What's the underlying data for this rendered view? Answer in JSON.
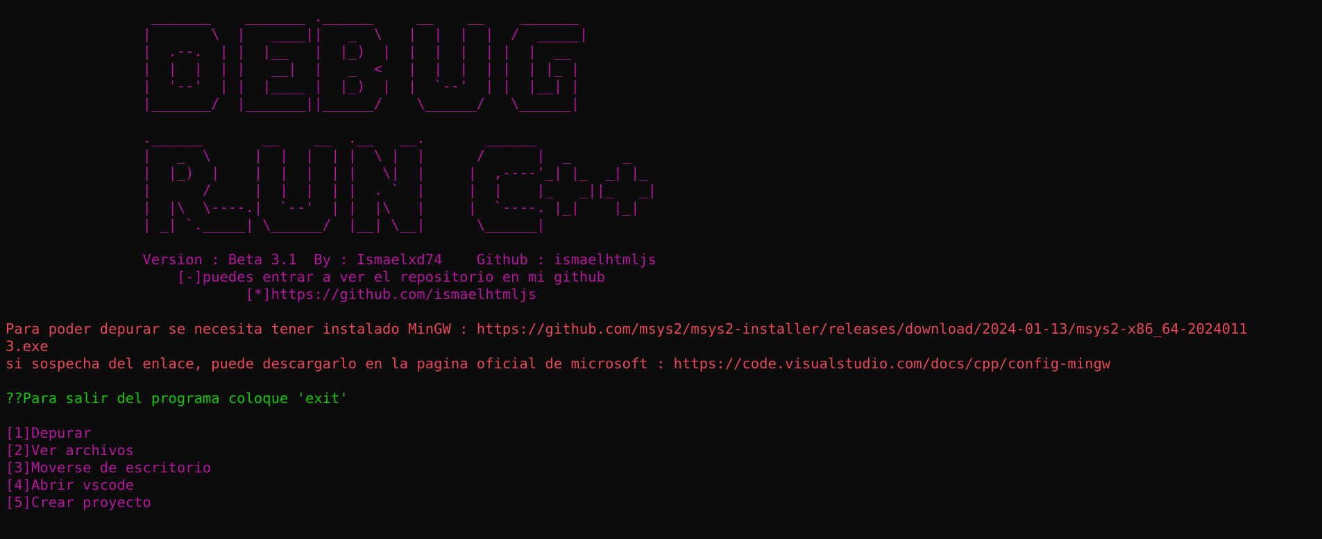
{
  "colors": {
    "background": "#0c0c0c",
    "magenta": "#b4169e",
    "red": "#e74856",
    "green": "#16c60c"
  },
  "banner": {
    "debug_art": "                 _______    _______ .______     __    __    _______ \n                |       \\  |   ____||   _  \\   |  |  |  |  /  _____|\n                |  .--.  | |  |__   |  |_)  |  |  |  |  | |  |  __  \n                |  |  |  | |   __|  |   _  <   |  |  |  | |  | |_ | \n                |  '--'  | |  |____ |  |_)  |  |  `--'  | |  |__| | \n                |_______/  |_______||______/    \\______/   \\______| ",
    "run_art": "                .______       __    __  .__   __.       ______     \n                |   _  \\     |  |  |  | |  \\ |  |      /      |  _      _   \n                |  |_)  |    |  |  |  | |   \\|  |     |  ,----'_| |_  _| |_ \n                |      /     |  |  |  | |  . `  |     |  |    |_   _||_   _|\n                |  |\\  \\----.|  `--'  | |  |\\   |     |  `----. |_|    |_|  \n                | _| `._____| \\______/  |__| \\__|      \\______|             ",
    "version_line": "                Version : Beta 3.1  By : Ismaelxd74    Github : ismaelhtmljs",
    "repo_line": "                    [-]puedes entrar a ver el repositorio en mi github",
    "url_line": "                            [*]https://github.com/ismaelhtmljs"
  },
  "notice": {
    "line1": "Para poder depurar se necesita tener instalado MinGW : https://github.com/msys2/msys2-installer/releases/download/2024-01-13/msys2-x86_64-2024011",
    "line2": "3.exe",
    "line3": "si sospecha del enlace, puede descargarlo en la pagina oficial de microsoft : https://code.visualstudio.com/docs/cpp/config-mingw"
  },
  "exit_hint": "??Para salir del programa coloque 'exit'",
  "menu": {
    "items": [
      "[1]Depurar",
      "[2]Ver archivos",
      "[3]Moverse de escritorio",
      "[4]Abrir vscode",
      "[5]Crear proyecto"
    ]
  }
}
